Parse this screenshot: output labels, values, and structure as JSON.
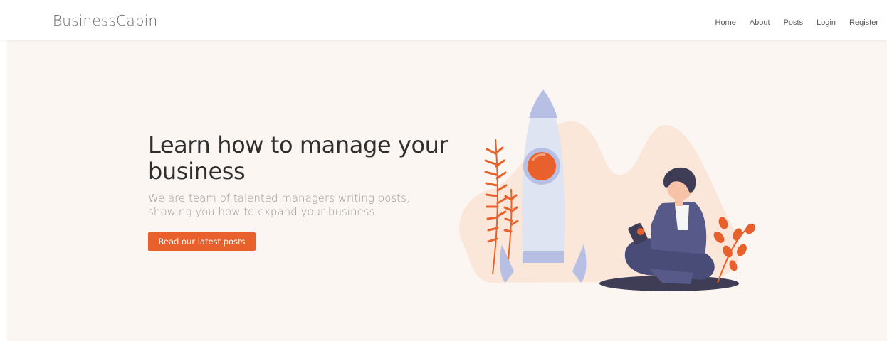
{
  "nav": {
    "brand": "BusinessCabin",
    "links": [
      "Home",
      "About",
      "Posts",
      "Login",
      "Register"
    ]
  },
  "hero": {
    "title": "Learn how to manage your business",
    "subtitle": "We are team of talented managers writing posts, showing you how to expand your business",
    "cta_label": "Read our latest posts"
  },
  "colors": {
    "accent": "#e8612c",
    "hero_bg": "#fcf6f2",
    "rocket": "#dfe4f3",
    "person": "#575a89"
  },
  "illustration": {
    "icon": "rocket-and-person-illustration"
  }
}
